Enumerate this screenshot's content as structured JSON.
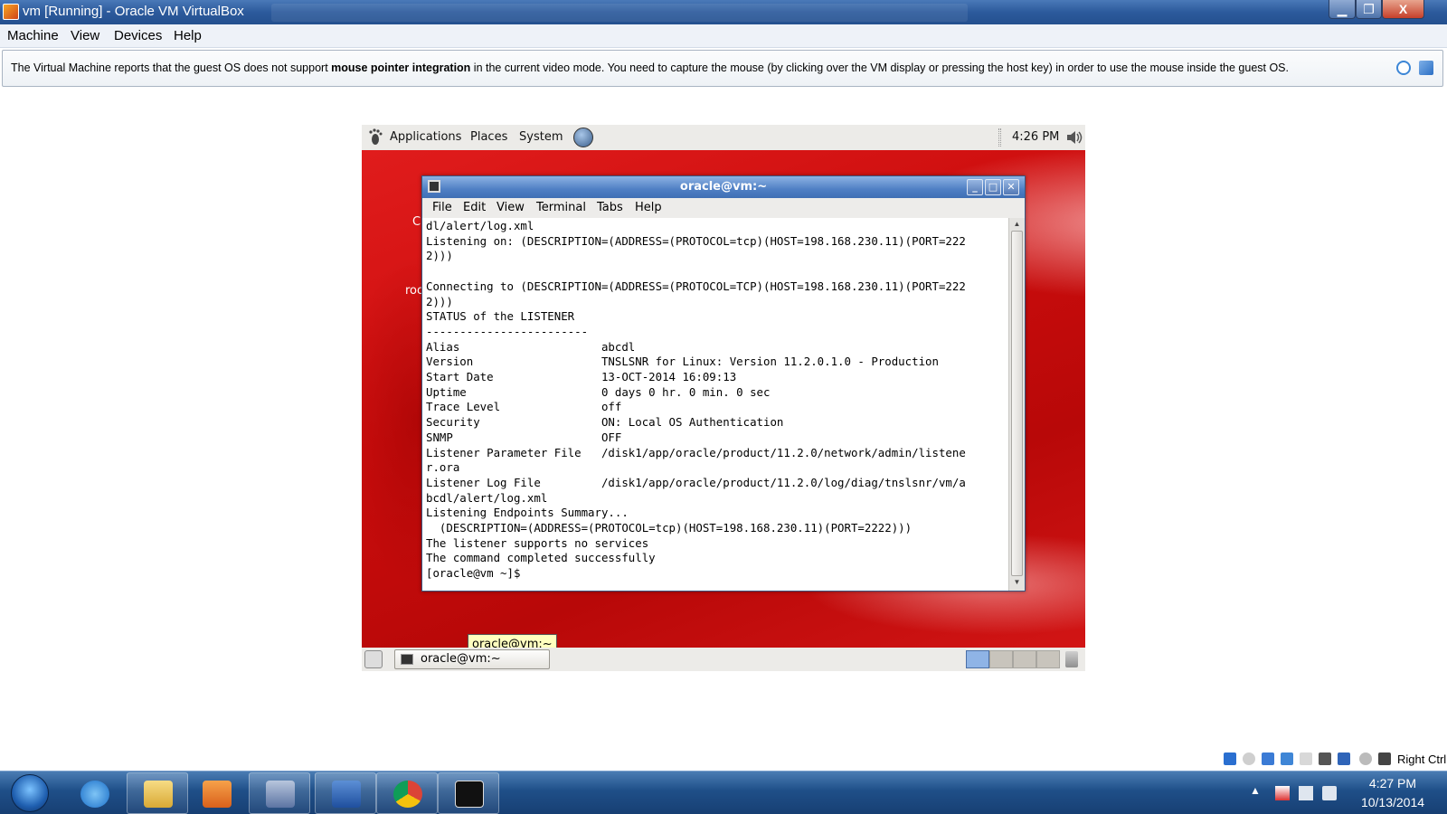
{
  "host_window": {
    "title": "vm [Running] - Oracle VM VirtualBox",
    "minimize": "▁",
    "maximize": "❐",
    "close": "X"
  },
  "host_menu": [
    "Machine",
    "View",
    "Devices",
    "Help"
  ],
  "notification": {
    "text_before": "The Virtual Machine reports that the guest OS does not support ",
    "bold": "mouse pointer integration",
    "text_after": " in the current video mode. You need to capture the mouse (by clicking over the VM display or pressing the host key) in order to use the mouse inside the guest OS."
  },
  "guest_panel": {
    "menus": [
      "Applications",
      "Places",
      "System"
    ],
    "clock": "4:26 PM"
  },
  "desktop_labels": [
    "C",
    "roo"
  ],
  "terminal": {
    "title": "oracle@vm:~",
    "menus": [
      "File",
      "Edit",
      "View",
      "Terminal",
      "Tabs",
      "Help"
    ],
    "lines": [
      "dl/alert/log.xml",
      "Listening on: (DESCRIPTION=(ADDRESS=(PROTOCOL=tcp)(HOST=198.168.230.11)(PORT=222",
      "2)))",
      "",
      "Connecting to (DESCRIPTION=(ADDRESS=(PROTOCOL=TCP)(HOST=198.168.230.11)(PORT=222",
      "2)))",
      "STATUS of the LISTENER",
      "------------------------",
      "Alias                     abcdl",
      "Version                   TNSLSNR for Linux: Version 11.2.0.1.0 - Production",
      "Start Date                13-OCT-2014 16:09:13",
      "Uptime                    0 days 0 hr. 0 min. 0 sec",
      "Trace Level               off",
      "Security                  ON: Local OS Authentication",
      "SNMP                      OFF",
      "Listener Parameter File   /disk1/app/oracle/product/11.2.0/network/admin/listene",
      "r.ora",
      "Listener Log File         /disk1/app/oracle/product/11.2.0/log/diag/tnslsnr/vm/a",
      "bcdl/alert/log.xml",
      "Listening Endpoints Summary...",
      "  (DESCRIPTION=(ADDRESS=(PROTOCOL=tcp)(HOST=198.168.230.11)(PORT=2222)))",
      "The listener supports no services",
      "The command completed successfully",
      "[oracle@vm ~]$ "
    ]
  },
  "tooltip": "oracle@vm:~",
  "guest_taskbar": {
    "task_label": "oracle@vm:~"
  },
  "vb_status": {
    "host_key": "Right Ctrl"
  },
  "windows_tray": {
    "time": "4:27 PM",
    "date": "10/13/2014"
  },
  "colors": {
    "desktop_red": "#cc0d0d",
    "titlebar_blue": "#2c5a9c",
    "terminal_title": "#4f7fc4"
  }
}
